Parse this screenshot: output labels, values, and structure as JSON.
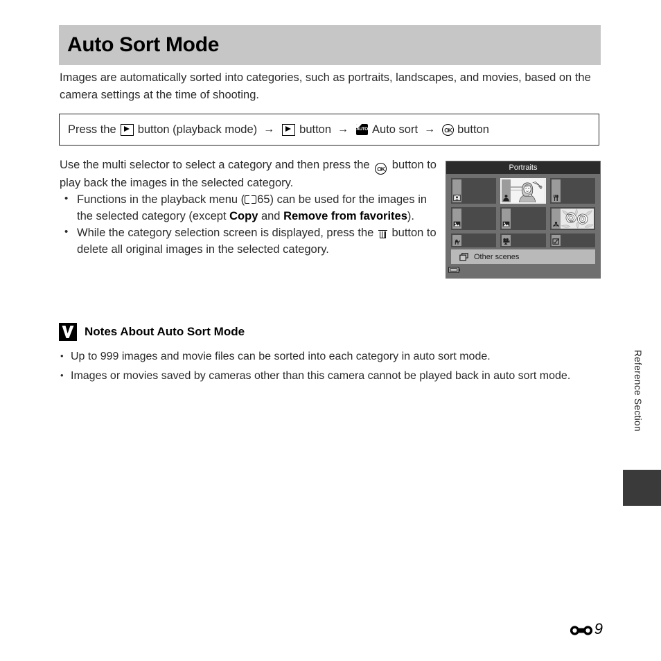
{
  "page": {
    "title": "Auto Sort Mode",
    "intro": "Images are automatically sorted into categories, such as portraits, landscapes, and movies, based on the camera settings at the time of shooting.",
    "side_label": "Reference Section",
    "page_number": "9",
    "page_mark_icon": "reference-section-mark"
  },
  "nav_path": {
    "segment_1_pre": "Press the",
    "icon_1": "playback-button-icon",
    "segment_1_post": "button (playback mode)",
    "arrow": "→",
    "icon_2": "playback-button-icon",
    "segment_2": "button",
    "icon_3": "auto-sort-icon",
    "segment_3": "Auto sort",
    "icon_4": "ok-button-icon",
    "segment_4": "button"
  },
  "body": {
    "lead_pre": "Use the multi selector to select a category and then press the",
    "lead_icon": "ok-button-icon",
    "lead_post": "button to play back the images in the selected category.",
    "bullets": [
      {
        "bullet": "•",
        "part1": "Functions in the playback menu (",
        "icon": "manual-book-icon",
        "part2": "65) can be used for the images in the selected category (except ",
        "bold1": "Copy",
        "part3": " and ",
        "bold2": "Remove from favorites",
        "part4": ")."
      },
      {
        "bullet": "•",
        "part1": "While the category selection screen is displayed, press the ",
        "icon": "delete-trash-icon",
        "part2": " button to delete all original images in the selected category."
      }
    ]
  },
  "camera_screen": {
    "title": "Portraits",
    "footer_label": "Other scenes",
    "footer_icon": "multiple-frames-icon",
    "battery_icon": "battery-icon",
    "cells": [
      {
        "name": "cell-smart-portrait",
        "icon": "smart-portrait-icon",
        "selected": false,
        "thumb": "empty"
      },
      {
        "name": "cell-portraits",
        "icon": "portrait-person-icon",
        "selected": true,
        "thumb": "portrait-photo"
      },
      {
        "name": "cell-food",
        "icon": "food-icon",
        "selected": false,
        "thumb": "empty"
      },
      {
        "name": "cell-landscape",
        "icon": "landscape-icon",
        "selected": false,
        "thumb": "empty"
      },
      {
        "name": "cell-scenery",
        "icon": "landscape-icon",
        "selected": false,
        "thumb": "empty"
      },
      {
        "name": "cell-close-ups",
        "icon": "flower-macro-icon",
        "selected": false,
        "thumb": "flower-photo"
      },
      {
        "name": "cell-pet-portrait",
        "icon": "pet-cat-icon",
        "selected": false,
        "thumb": "empty"
      },
      {
        "name": "cell-movies",
        "icon": "movie-camera-icon",
        "selected": false,
        "thumb": "empty"
      },
      {
        "name": "cell-retouched-copies",
        "icon": "retouch-icon",
        "selected": false,
        "thumb": "empty"
      }
    ]
  },
  "notes": {
    "icon": "caution-check-icon",
    "heading": "Notes About Auto Sort Mode",
    "items": [
      {
        "bullet": "•",
        "text": "Up to 999 images and movie files can be sorted into each category in auto sort mode."
      },
      {
        "bullet": "•",
        "text": "Images or movies saved by cameras other than this camera cannot be played back in auto sort mode."
      }
    ]
  },
  "colors": {
    "header_bar": "#c6c6c6",
    "camera_titlebar": "#2b2b2b",
    "camera_body": "#6f6f6f",
    "camera_cell": "#4a4a4a",
    "camera_strip": "#9b9b9b",
    "camera_footer": "#b9b9b9",
    "side_tab": "#3a3a3a",
    "text": "#2a2a2a"
  }
}
